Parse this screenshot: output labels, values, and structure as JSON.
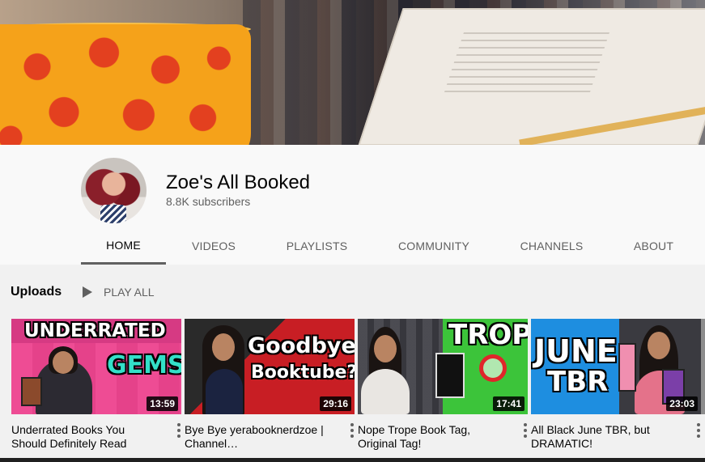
{
  "channel": {
    "name": "Zoe's All Booked",
    "subscribers": "8.8K subscribers"
  },
  "tabs": [
    {
      "label": "HOME",
      "active": true
    },
    {
      "label": "VIDEOS",
      "active": false
    },
    {
      "label": "PLAYLISTS",
      "active": false
    },
    {
      "label": "COMMUNITY",
      "active": false
    },
    {
      "label": "CHANNELS",
      "active": false
    },
    {
      "label": "ABOUT",
      "active": false
    }
  ],
  "uploads": {
    "title": "Uploads",
    "play_all": "PLAY ALL"
  },
  "videos": [
    {
      "title": "Underrated Books You Should Definitely Read",
      "duration": "13:59",
      "thumb_text": [
        "UNDERRATED",
        "GEMS"
      ],
      "colors": {
        "bg": "#ee4c94",
        "accent": "#33e0c8"
      }
    },
    {
      "title": "Bye Bye yerabooknerdzoe | Channel…",
      "duration": "29:16",
      "thumb_text": [
        "Goodbye",
        "Booktube?"
      ],
      "colors": {
        "bg": "#c81e24",
        "accent": "#ffffff"
      }
    },
    {
      "title": "Nope Trope Book Tag, Original Tag!",
      "duration": "17:41",
      "thumb_text": [
        "TROPE"
      ],
      "colors": {
        "bg": "#3cc43a",
        "accent": "#e0262a"
      }
    },
    {
      "title": "All Black June TBR, but DRAMATIC!",
      "duration": "23:03",
      "thumb_text": [
        "JUNE",
        "TBR"
      ],
      "colors": {
        "bg": "#1e8ee0",
        "accent": "#ffffff"
      }
    }
  ],
  "icons": {
    "play_all": "play-triangle-icon",
    "menu": "kebab-menu-icon"
  }
}
